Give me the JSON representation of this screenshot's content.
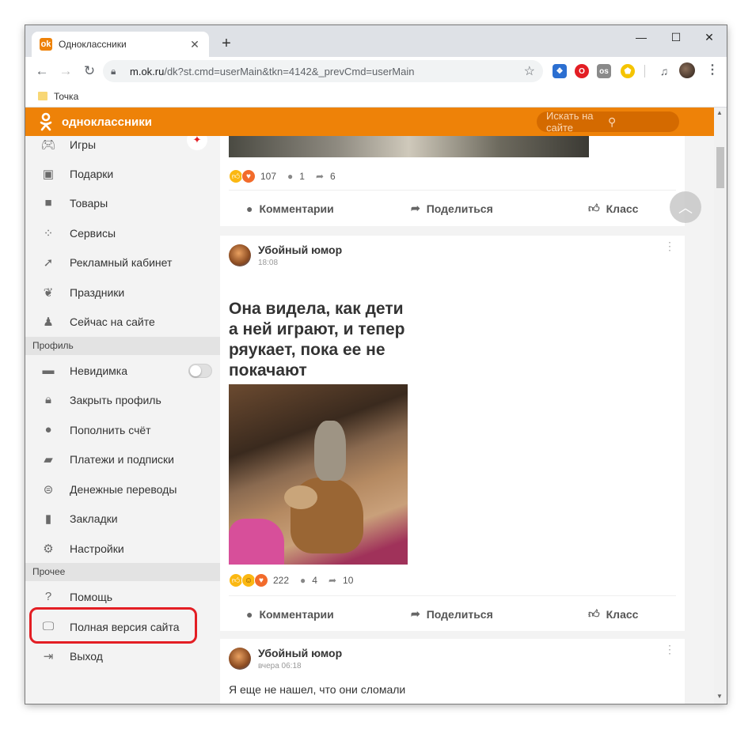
{
  "browser": {
    "tab_title": "Одноклассники",
    "tab_favicon": "ok",
    "new_tab": "+",
    "controls": {
      "minimize": "—",
      "maximize": "☐",
      "close": "✕"
    },
    "url_host": "m.ok.ru",
    "url_path": "/dk?st.cmd=userMain&tkn=4142&_prevCmd=userMain",
    "bookmark": "Точка",
    "extensions": [
      {
        "name": "vpn-icon",
        "color": "#2c6fd1",
        "glyph": "❖"
      },
      {
        "name": "opera-icon",
        "color": "#e31e24",
        "glyph": "O"
      },
      {
        "name": "os-icon",
        "color": "#8a8a8a",
        "glyph": "os"
      },
      {
        "name": "shield-icon",
        "color": "#f5c400",
        "glyph": "⬟"
      }
    ]
  },
  "ok": {
    "brand": "одноклассники",
    "brand_color": "#ee8208",
    "search_placeholder": "Искать на сайте"
  },
  "sidebar": {
    "items_main": [
      {
        "label": "Игры",
        "icon": "gamepad-icon"
      },
      {
        "label": "Подарки",
        "icon": "gift-icon"
      },
      {
        "label": "Товары",
        "icon": "bag-icon"
      },
      {
        "label": "Сервисы",
        "icon": "grid-icon"
      },
      {
        "label": "Рекламный кабинет",
        "icon": "arrow-icon"
      },
      {
        "label": "Праздники",
        "icon": "balloon-icon"
      },
      {
        "label": "Сейчас на сайте",
        "icon": "person-icon"
      }
    ],
    "section_profile": "Профиль",
    "items_profile": [
      {
        "label": "Невидимка",
        "icon": "hat-icon"
      },
      {
        "label": "Закрыть профиль",
        "icon": "lock-icon"
      },
      {
        "label": "Пополнить счёт",
        "icon": "coin-icon"
      },
      {
        "label": "Платежи и подписки",
        "icon": "wallet-icon"
      },
      {
        "label": "Денежные переводы",
        "icon": "transfer-icon"
      },
      {
        "label": "Закладки",
        "icon": "bookmark-icon"
      },
      {
        "label": "Настройки",
        "icon": "gear-icon"
      }
    ],
    "invisible_toggle_on": false,
    "section_other": "Прочее",
    "items_other": [
      {
        "label": "Помощь",
        "icon": "help-icon"
      },
      {
        "label": "Полная версия сайта",
        "icon": "monitor-icon"
      },
      {
        "label": "Выход",
        "icon": "exit-icon"
      }
    ],
    "highlight_color": "#e31e24"
  },
  "feed": {
    "post0": {
      "reactions": "107",
      "comments": "1",
      "shares": "6"
    },
    "actions": {
      "comments": "Комментарии",
      "share": "Поделиться",
      "like": "Класс"
    },
    "post1": {
      "author": "Убойный юмор",
      "time": "18:08",
      "meme_lines": [
        "Она видела, как дети",
        "а ней играют, и тепер",
        "ряукает, пока ее не",
        "покачают"
      ],
      "reactions": "222",
      "comments": "4",
      "shares": "10"
    },
    "post2": {
      "author": "Убойный юмор",
      "time": "вчера 06:18",
      "text": "Я еще не нашел, что они сломали"
    }
  }
}
